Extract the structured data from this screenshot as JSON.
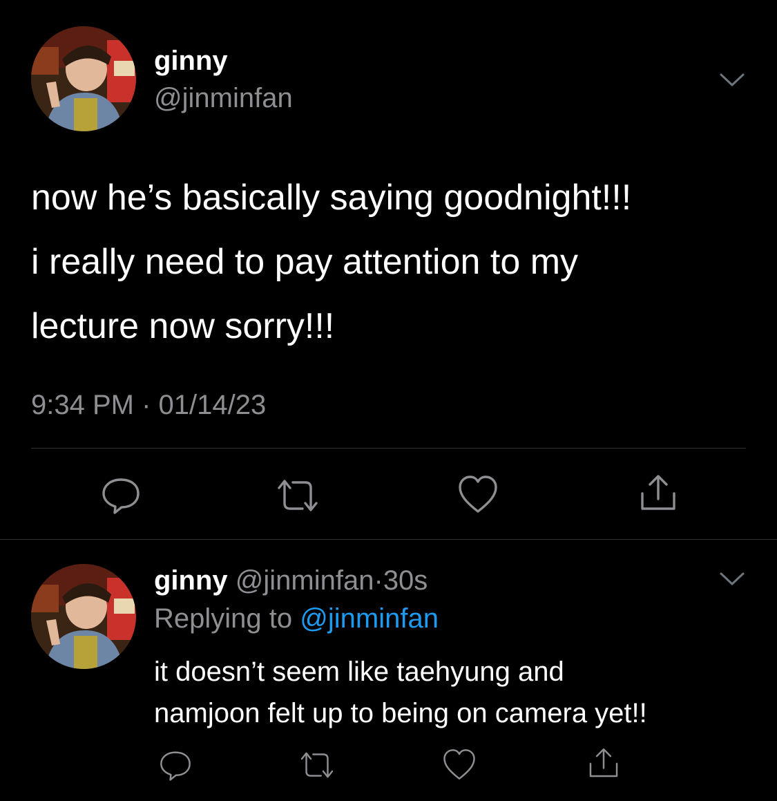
{
  "tweet": {
    "author_name": "ginny",
    "author_handle": "@jinminfan",
    "text_lines": [
      "now he’s basically saying goodnight!!!",
      "i really need to pay attention to my",
      "lecture now sorry!!!"
    ],
    "timestamp": "9:34 PM · 01/14/23"
  },
  "reply": {
    "author_name": "ginny",
    "author_handle": "@jinminfan",
    "separator": "·",
    "age": "30s",
    "replying_prefix": "Replying to",
    "replying_handle": "@jinminfan",
    "text_lines": [
      "it doesn’t seem like taehyung and",
      "namjoon felt up to being on camera yet!!"
    ]
  },
  "icons": {
    "reply": "comment-icon",
    "retweet": "retweet-icon",
    "like": "heart-icon",
    "share": "share-icon",
    "menu": "chevron-down-icon"
  },
  "colors": {
    "background": "#000000",
    "text": "#ffffff",
    "secondary": "#8e8e93",
    "link": "#1d9bf0",
    "divider": "#2f3336"
  }
}
